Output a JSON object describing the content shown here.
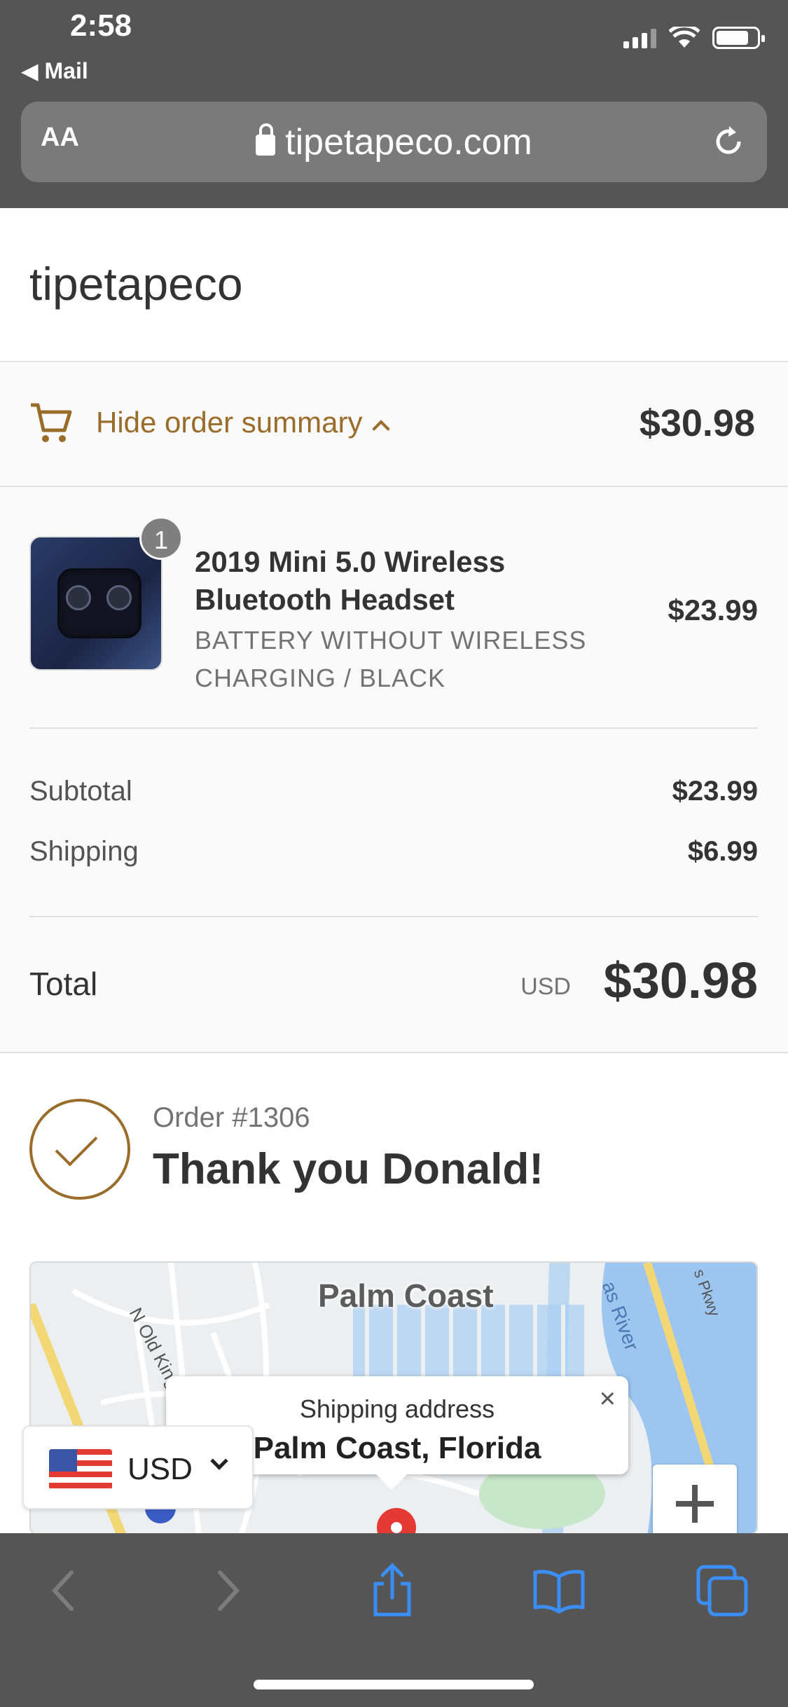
{
  "status_bar": {
    "time": "2:58",
    "back_app": "◀ Mail",
    "icons": [
      "cellular-signal-icon",
      "wifi-icon",
      "battery-icon"
    ]
  },
  "browser": {
    "text_size_label": "AA",
    "url": "tipetapeco.com",
    "icons": [
      "lock-icon",
      "reload-icon"
    ]
  },
  "store": {
    "name": "tipetapeco"
  },
  "order_summary": {
    "toggle_label": "Hide order summary",
    "toggle_total": "$30.98",
    "product": {
      "quantity": "1",
      "title": "2019 Mini 5.0 Wireless Bluetooth Headset",
      "variant": "BATTERY WITHOUT WIRELESS CHARGING / BLACK",
      "price": "$23.99"
    },
    "subtotal_label": "Subtotal",
    "subtotal_value": "$23.99",
    "shipping_label": "Shipping",
    "shipping_value": "$6.99",
    "total_label": "Total",
    "total_currency": "USD",
    "total_value": "$30.98"
  },
  "confirmation": {
    "order_number": "Order #1306",
    "message": "Thank you Donald!"
  },
  "map": {
    "city_label": "Palm Coast",
    "river_label": "as River",
    "road_label": "N Old Kings Rd",
    "pkwy_label": "s Pkwy",
    "popup_title": "Shipping address",
    "popup_place": "Palm Coast, Florida",
    "popup_close": "×"
  },
  "currency_selector": {
    "value": "USD"
  },
  "toolbar": {
    "icons": [
      "back-icon",
      "forward-icon",
      "share-icon",
      "bookmarks-icon",
      "tabs-icon"
    ]
  },
  "colors": {
    "accent": "#9a6c2a",
    "chrome": "#555555",
    "ios_blue": "#3b8ef5"
  }
}
